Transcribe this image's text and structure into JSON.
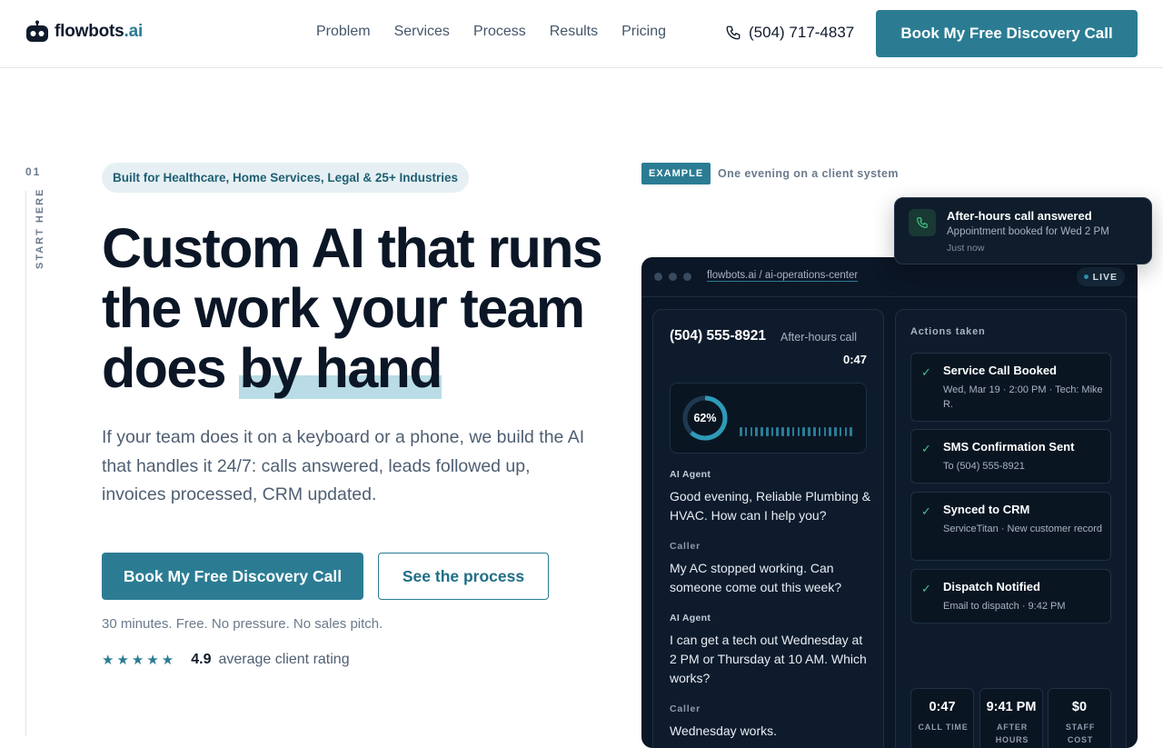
{
  "brand": {
    "name": "flowbots",
    "suffix": ".ai"
  },
  "nav": {
    "items": [
      "Problem",
      "Services",
      "Process",
      "Results",
      "Pricing"
    ],
    "phone": "(504) 717-4837",
    "cta": "Book My Free Discovery Call"
  },
  "rail": {
    "number": "01",
    "label": "START HERE"
  },
  "hero": {
    "badge": "Built for Healthcare, Home Services, Legal & 25+ Industries",
    "headline_part1": "Custom AI that runs the work your team does ",
    "headline_highlight": "by hand",
    "subtext": "If your team does it on a keyboard or a phone, we build the AI that handles it 24/7: calls answered, leads followed up, invoices processed, CRM updated.",
    "primary_cta": "Book My Free Discovery Call",
    "secondary_cta": "See the process",
    "fineprint": "30 minutes. Free. No pressure. No sales pitch.",
    "stars": "★★★★★",
    "rating_value": "4.9",
    "rating_text": "average client rating"
  },
  "example": {
    "tag": "EXAMPLE",
    "caption": "One evening on a client system"
  },
  "toast": {
    "title": "After-hours call answered",
    "subtitle": "Appointment booked for Wed 2 PM",
    "time": "Just now"
  },
  "window": {
    "url": "flowbots.ai / ai-operations-center",
    "status": "LIVE",
    "call": {
      "number": "(504) 555-8921",
      "type": "After-hours call",
      "duration": "0:47",
      "progress_label": "62%",
      "progress": 0.62
    },
    "transcript": [
      {
        "speaker": "AI Agent",
        "text": "Good evening, Reliable Plumbing & HVAC. How can I help you?"
      },
      {
        "speaker": "Caller",
        "text": "My AC stopped working. Can someone come out this week?"
      },
      {
        "speaker": "AI Agent",
        "text": "I can get a tech out Wednesday at 2 PM or Thursday at 10 AM. Which works?"
      },
      {
        "speaker": "Caller",
        "text": "Wednesday works."
      }
    ],
    "actions_title": "Actions taken",
    "actions": [
      {
        "title": "Service Call Booked",
        "detail": "Wed, Mar 19 · 2:00 PM · Tech: Mike R."
      },
      {
        "title": "SMS Confirmation Sent",
        "detail": "To (504) 555-8921"
      },
      {
        "title": "Synced to CRM",
        "detail": "ServiceTitan · New customer record"
      },
      {
        "title": "Dispatch Notified",
        "detail": "Email to dispatch · 9:42 PM"
      }
    ],
    "stats": [
      {
        "value": "0:47",
        "label": "CALL TIME"
      },
      {
        "value": "9:41 PM",
        "label": "AFTER HOURS"
      },
      {
        "value": "$0",
        "label": "STAFF COST"
      }
    ]
  },
  "colors": {
    "accent": "#2b7c93",
    "dark_panel": "#0b1626",
    "success": "#47c28a"
  }
}
